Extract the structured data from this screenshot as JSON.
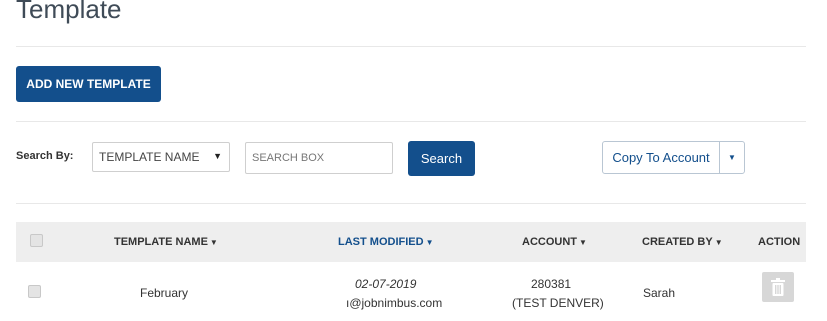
{
  "page": {
    "title": "Template"
  },
  "toolbar": {
    "add_label": "ADD NEW TEMPLATE"
  },
  "search": {
    "label": "Search By:",
    "select_value": "TEMPLATE NAME",
    "placeholder": "SEARCH BOX",
    "button_label": "Search",
    "copy_label": "Copy To Account"
  },
  "table": {
    "columns": {
      "template_name": "TEMPLATE NAME",
      "last_modified": "LAST MODIFIED",
      "account": "ACCOUNT",
      "created_by": "CREATED BY",
      "action": "ACTION"
    },
    "rows": [
      {
        "template_name": "February",
        "modified_date": "02-07-2019",
        "modified_by": "ı@jobnimbus.com",
        "account_id": "280381",
        "account_name": "(TEST DENVER)",
        "created_by": "Sarah"
      }
    ]
  },
  "colors": {
    "primary": "#134f8c",
    "header_bg": "#eeeeee",
    "title": "#3f4b57"
  },
  "icons": {
    "sort": "caret-down-icon",
    "delete": "trash-icon",
    "dropdown": "caret-down-icon"
  }
}
